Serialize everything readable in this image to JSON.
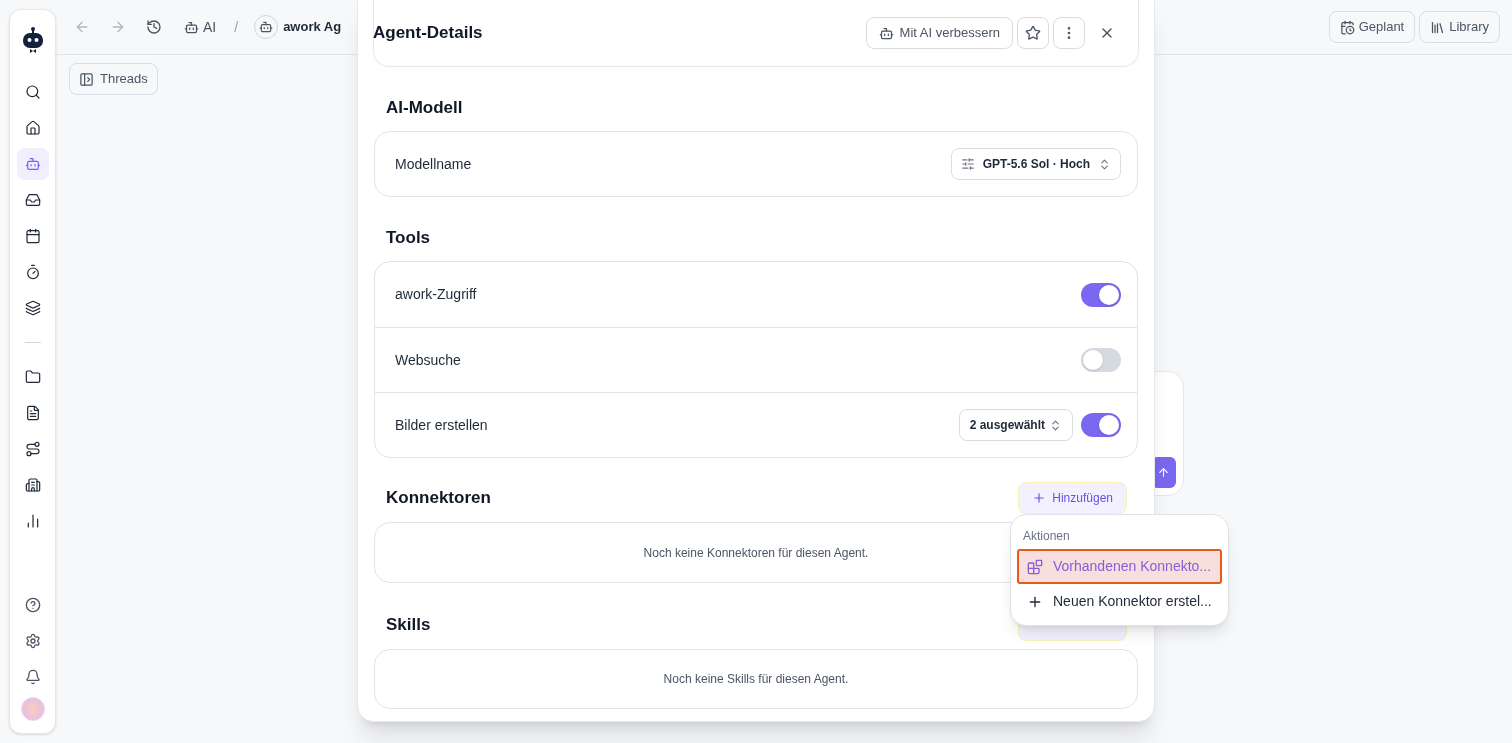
{
  "nav_items": [
    {
      "selected": false
    },
    {
      "selected": false
    },
    {
      "selected": true
    },
    {
      "selected": false
    },
    {
      "selected": false
    },
    {
      "selected": false
    },
    {
      "selected": false
    },
    {
      "selected": false
    },
    {
      "selected": false
    },
    {
      "selected": false
    },
    {
      "selected": false
    },
    {
      "selected": false
    }
  ],
  "topbar": {
    "breadcrumb": [
      "AI",
      "awork Ag"
    ],
    "separator": "/",
    "buttons": [
      "Geplant",
      "Library"
    ]
  },
  "threads_button": "Threads",
  "modal": {
    "title": "Agent-Details",
    "improve_button": "Mit AI verbessern",
    "model_section": {
      "title": "AI-Modell",
      "label": "Modellname",
      "value": "GPT-5.6 Sol · Hoch"
    },
    "tools_section": {
      "title": "Tools",
      "rows": [
        {
          "kind": "toggle",
          "label": "awork-Zugriff",
          "on": true
        },
        {
          "kind": "toggle",
          "label": "Websuche",
          "on": false
        },
        {
          "kind": "select_toggle",
          "label": "Bilder erstellen",
          "select": "2 ausgewählt",
          "on": true
        }
      ]
    },
    "connectors_section": {
      "title": "Konnektoren",
      "add_button": "Hinzufügen",
      "empty": "Noch keine Konnektoren für diesen Agent."
    },
    "skills_section": {
      "title": "Skills",
      "empty": "Noch keine Skills für diesen Agent."
    }
  },
  "menu": {
    "title": "Aktionen",
    "items": [
      {
        "kind": "existing",
        "label": "Vorhandenen Konnekto...",
        "selected": true
      },
      {
        "kind": "new",
        "label": "Neuen Konnektor erstel...",
        "selected": false
      }
    ]
  }
}
